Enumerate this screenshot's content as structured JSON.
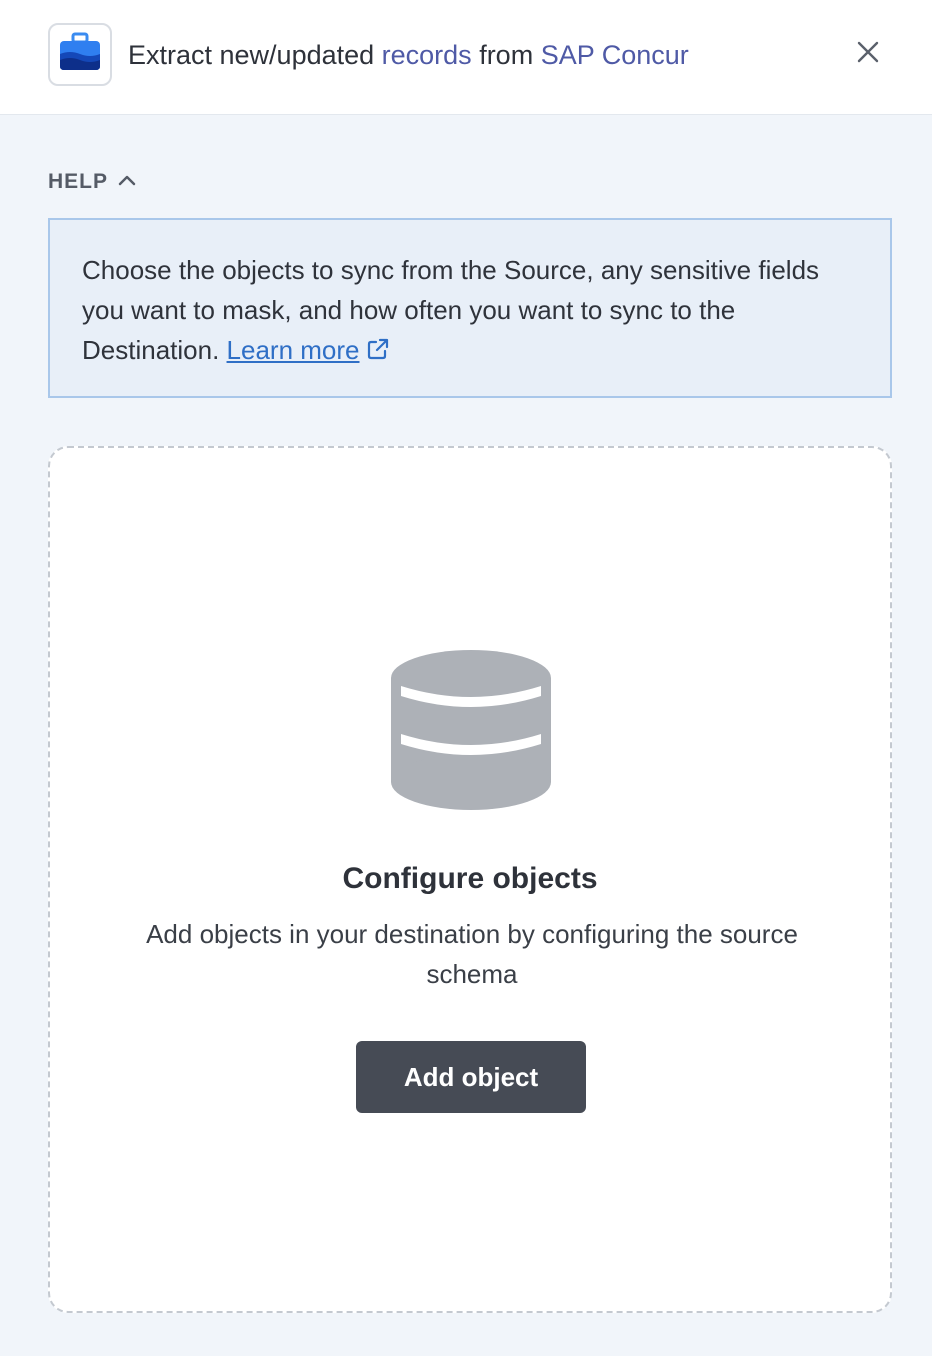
{
  "header": {
    "title_prefix": "Extract new/updated ",
    "title_link_records": "records",
    "title_middle": " from ",
    "title_link_source": "SAP Concur",
    "app_icon": "briefcase-icon",
    "close_icon": "close-icon"
  },
  "help": {
    "label": "HELP",
    "toggle_icon": "chevron-up-icon",
    "text": "Choose the objects to sync from the Source, any sensitive fields you want to mask, and how often you want to sync to the Destination. ",
    "link_text": "Learn more",
    "link_icon": "external-link-icon"
  },
  "config": {
    "icon": "database-icon",
    "title": "Configure objects",
    "description": "Add objects in your destination by configuring the source schema",
    "button_label": "Add object"
  },
  "colors": {
    "link": "#4f5aa6",
    "help_bg": "#e8eff8",
    "help_border": "#a9c7ea",
    "button_bg": "#464b55",
    "icon_blue": "#1d5fd6"
  }
}
